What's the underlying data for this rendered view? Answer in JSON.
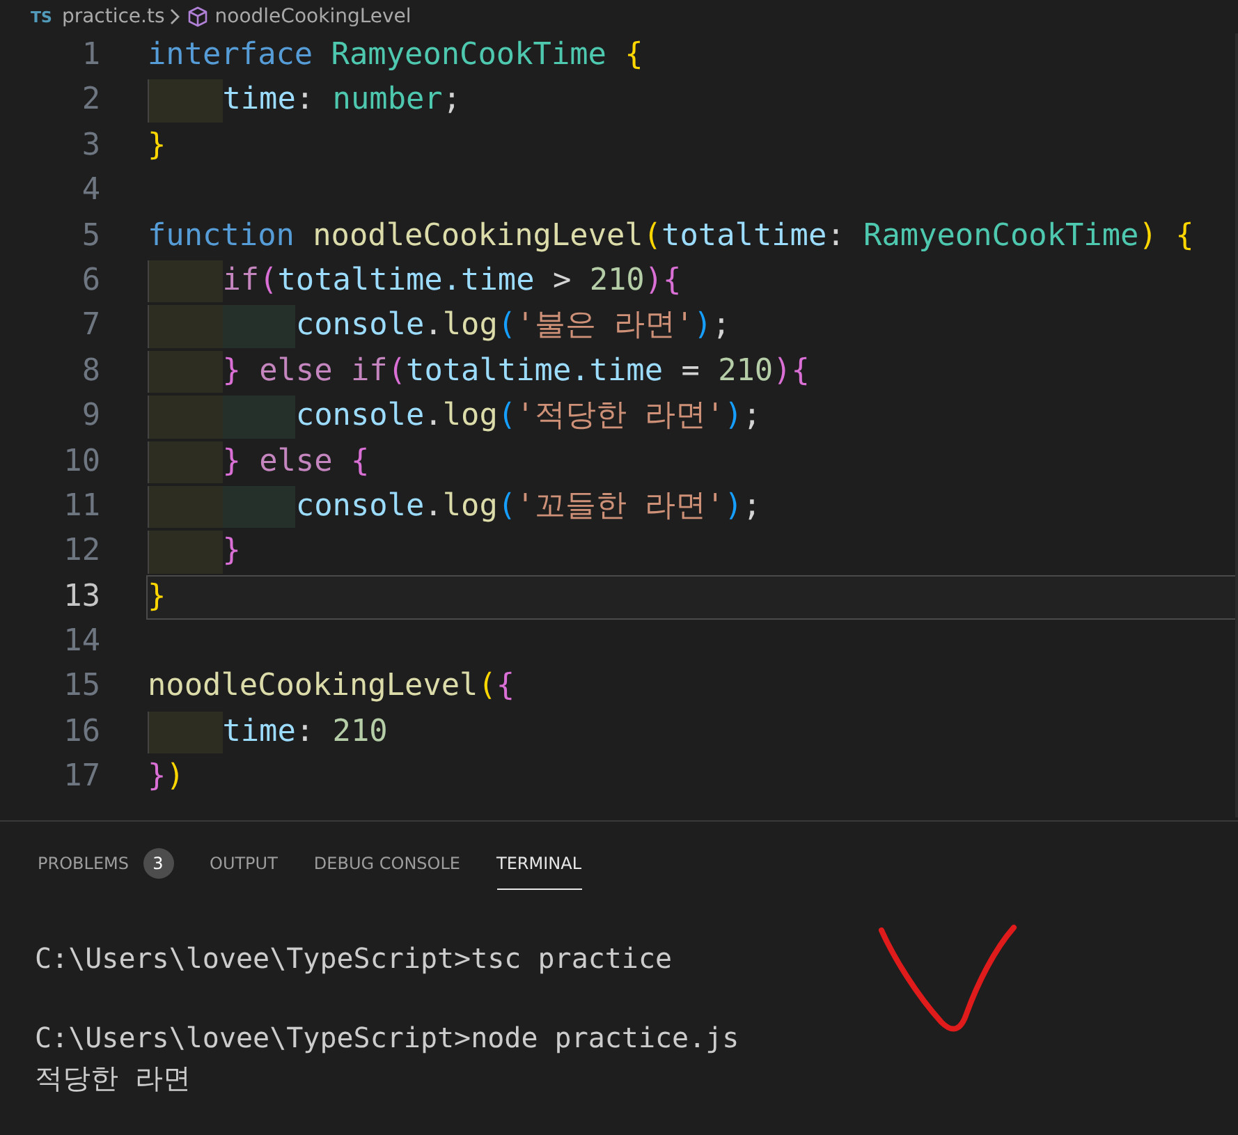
{
  "breadcrumb": {
    "file_badge": "TS",
    "file": "practice.ts",
    "symbol": "noodleCookingLevel"
  },
  "lines": [
    {
      "number": "1",
      "selected": false,
      "tokens": [
        {
          "kind": "keyword",
          "text": "interface "
        },
        {
          "kind": "type",
          "text": "RamyeonCookTime "
        },
        {
          "kind": "bracket1",
          "text": "{"
        }
      ]
    },
    {
      "number": "2",
      "selected": false,
      "tokens": [
        {
          "kind": "variable",
          "text": "    time"
        },
        {
          "kind": "punct",
          "text": ": "
        },
        {
          "kind": "type",
          "text": "number"
        },
        {
          "kind": "punct",
          "text": ";"
        }
      ]
    },
    {
      "number": "3",
      "selected": false,
      "tokens": [
        {
          "kind": "bracket1",
          "text": "}"
        }
      ]
    },
    {
      "number": "4",
      "selected": false
    },
    {
      "number": "5",
      "selected": false,
      "tokens": [
        {
          "kind": "keyword",
          "text": "function "
        },
        {
          "kind": "function",
          "text": "noodleCookingLevel"
        },
        {
          "kind": "bracket1",
          "text": "("
        },
        {
          "kind": "variable",
          "text": "totaltime"
        },
        {
          "kind": "punct",
          "text": ": "
        },
        {
          "kind": "type",
          "text": "RamyeonCookTime"
        },
        {
          "kind": "bracket1",
          "text": ") {"
        }
      ]
    },
    {
      "number": "6",
      "selected": false,
      "tokens": [
        {
          "kind": "control",
          "text": "    if"
        },
        {
          "kind": "bracket2",
          "text": "("
        },
        {
          "kind": "variable",
          "text": "totaltime.time "
        },
        {
          "kind": "punct",
          "text": "> "
        },
        {
          "kind": "number",
          "text": "210"
        },
        {
          "kind": "bracket2",
          "text": "){"
        }
      ]
    },
    {
      "number": "7",
      "selected": false,
      "tokens": [
        {
          "kind": "variable",
          "text": "        console"
        },
        {
          "kind": "punct",
          "text": "."
        },
        {
          "kind": "function",
          "text": "log"
        },
        {
          "kind": "bracket3",
          "text": "("
        },
        {
          "kind": "string",
          "text": "'불은 라면'"
        },
        {
          "kind": "bracket3",
          "text": ")"
        },
        {
          "kind": "punct",
          "text": ";"
        }
      ]
    },
    {
      "number": "8",
      "selected": false,
      "tokens": [
        {
          "kind": "bracket2",
          "text": "    } "
        },
        {
          "kind": "control",
          "text": "else if"
        },
        {
          "kind": "bracket2",
          "text": "("
        },
        {
          "kind": "variable",
          "text": "totaltime.time "
        },
        {
          "kind": "punct",
          "text": "= "
        },
        {
          "kind": "number",
          "text": "210"
        },
        {
          "kind": "bracket2",
          "text": "){"
        }
      ]
    },
    {
      "number": "9",
      "selected": false,
      "tokens": [
        {
          "kind": "variable",
          "text": "        console"
        },
        {
          "kind": "punct",
          "text": "."
        },
        {
          "kind": "function",
          "text": "log"
        },
        {
          "kind": "bracket3",
          "text": "("
        },
        {
          "kind": "string",
          "text": "'적당한 라면'"
        },
        {
          "kind": "bracket3",
          "text": ")"
        },
        {
          "kind": "punct",
          "text": ";"
        }
      ]
    },
    {
      "number": "10",
      "selected": false,
      "tokens": [
        {
          "kind": "bracket2",
          "text": "    } "
        },
        {
          "kind": "control",
          "text": "else "
        },
        {
          "kind": "bracket2",
          "text": "{"
        }
      ]
    },
    {
      "number": "11",
      "selected": false,
      "tokens": [
        {
          "kind": "variable",
          "text": "        console"
        },
        {
          "kind": "punct",
          "text": "."
        },
        {
          "kind": "function",
          "text": "log"
        },
        {
          "kind": "bracket3",
          "text": "("
        },
        {
          "kind": "string",
          "text": "'꼬들한 라면'"
        },
        {
          "kind": "bracket3",
          "text": ")"
        },
        {
          "kind": "punct",
          "text": ";"
        }
      ]
    },
    {
      "number": "12",
      "selected": false,
      "tokens": [
        {
          "kind": "bracket2",
          "text": "    }"
        }
      ]
    },
    {
      "number": "13",
      "selected": true,
      "tokens": [
        {
          "kind": "bracket1",
          "text": "}"
        }
      ]
    },
    {
      "number": "14",
      "selected": false
    },
    {
      "number": "15",
      "selected": false,
      "tokens": [
        {
          "kind": "function",
          "text": "noodleCookingLevel"
        },
        {
          "kind": "bracket1",
          "text": "("
        },
        {
          "kind": "bracket2",
          "text": "{"
        }
      ]
    },
    {
      "number": "16",
      "selected": false,
      "tokens": [
        {
          "kind": "variable",
          "text": "    time"
        },
        {
          "kind": "punct",
          "text": ": "
        },
        {
          "kind": "number",
          "text": "210"
        }
      ]
    },
    {
      "number": "17",
      "selected": false,
      "tokens": [
        {
          "kind": "bracket2",
          "text": "}"
        },
        {
          "kind": "bracket1",
          "text": ")"
        }
      ]
    }
  ],
  "panel_tabs": [
    {
      "label": "PROBLEMS",
      "badge": "3",
      "selected": false
    },
    {
      "label": "OUTPUT",
      "selected": false
    },
    {
      "label": "DEBUG CONSOLE",
      "selected": false
    },
    {
      "label": "TERMINAL",
      "selected": true
    }
  ],
  "terminal": [
    "C:\\Users\\lovee\\TypeScript>tsc practice",
    "C:\\Users\\lovee\\TypeScript>node practice.js",
    "적당한 라면"
  ]
}
